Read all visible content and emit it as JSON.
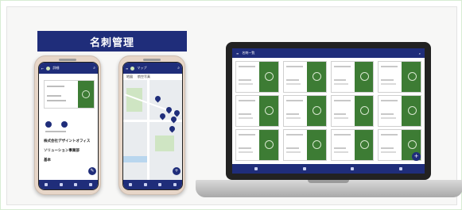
{
  "banner": {
    "title": "名刺管理"
  },
  "phone1": {
    "appbar_title": "詳細",
    "company": "株式会社デザイントオフィス",
    "department": "ソリューション事業部",
    "person": "基本"
  },
  "phone2": {
    "appbar_title": "マップ",
    "tabs": [
      "地図",
      "航空写真"
    ]
  },
  "laptop": {
    "appbar_title": "名刺一覧",
    "card_count": 12
  }
}
